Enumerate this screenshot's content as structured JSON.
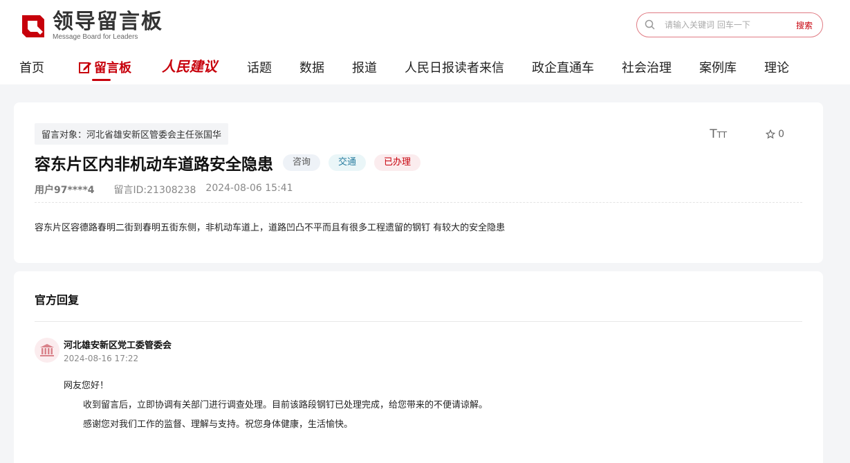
{
  "site": {
    "title": "领导留言板",
    "subtitle": "Message Board for Leaders"
  },
  "search": {
    "placeholder": "请输入关键词 回车一下",
    "button_label": "搜索"
  },
  "nav": {
    "items": [
      "首页",
      "留言板",
      "人民建议",
      "话题",
      "数据",
      "报道",
      "人民日报读者来信",
      "政企直通车",
      "社会治理",
      "案例库",
      "理论"
    ],
    "active_index": 1
  },
  "message": {
    "target": "留言对象：河北省雄安新区管委会主任张国华",
    "title": "容东片区内非机动车道路安全隐患",
    "tags": [
      "咨询",
      "交通",
      "已办理"
    ],
    "user": "用户97****4",
    "message_id": "留言ID:21308238",
    "datetime": "2024-08-06 15:41",
    "favorite_count": "0",
    "font_icon_label": "TT",
    "content": "容东片区容德路春明二街到春明五街东侧，非机动车道上，道路凹凸不平而且有很多工程遗留的钢钉  有较大的安全隐患"
  },
  "reply": {
    "heading": "官方回复",
    "org": "河北雄安新区党工委管委会",
    "datetime": "2024-08-16 17:22",
    "greeting": "网友您好！",
    "lines": [
      "收到留言后，立即协调有关部门进行调查处理。目前该路段钢钉已处理完成，给您带来的不便请谅解。",
      "感谢您对我们工作的监督、理解与支持。祝您身体健康，生活愉快。"
    ]
  },
  "colors": {
    "brand": "#c7000b",
    "background": "#f4f5f7"
  },
  "icons": [
    "logo-icon",
    "search-icon",
    "edit-icon",
    "font-size-icon",
    "star-icon",
    "government-building-icon"
  ]
}
